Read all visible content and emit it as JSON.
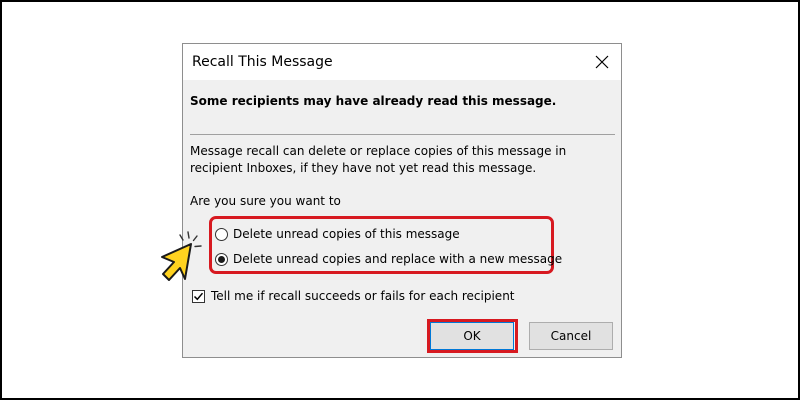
{
  "dialog": {
    "title": "Recall This Message",
    "warning": "Some recipients may have already read this message.",
    "description": "Message recall can delete or replace copies of this message in recipient Inboxes, if they have not yet read this message.",
    "prompt": "Are you sure you want to",
    "options": [
      {
        "label": "Delete unread copies of this message",
        "selected": false
      },
      {
        "label": "Delete unread copies and replace with a new message",
        "selected": true
      }
    ],
    "notify_checkbox": {
      "label": "Tell me if recall succeeds or fails for each recipient",
      "checked": true
    },
    "ok_label": "OK",
    "cancel_label": "Cancel"
  },
  "icons": {
    "close": "close-icon",
    "pointer": "hand-pointer-icon",
    "check": "checkmark-icon"
  },
  "colors": {
    "highlight": "#d71920",
    "dialog_bg": "#f0f0f0",
    "button_bg": "#e1e1e1",
    "pointer_fill": "#ffd21f"
  }
}
